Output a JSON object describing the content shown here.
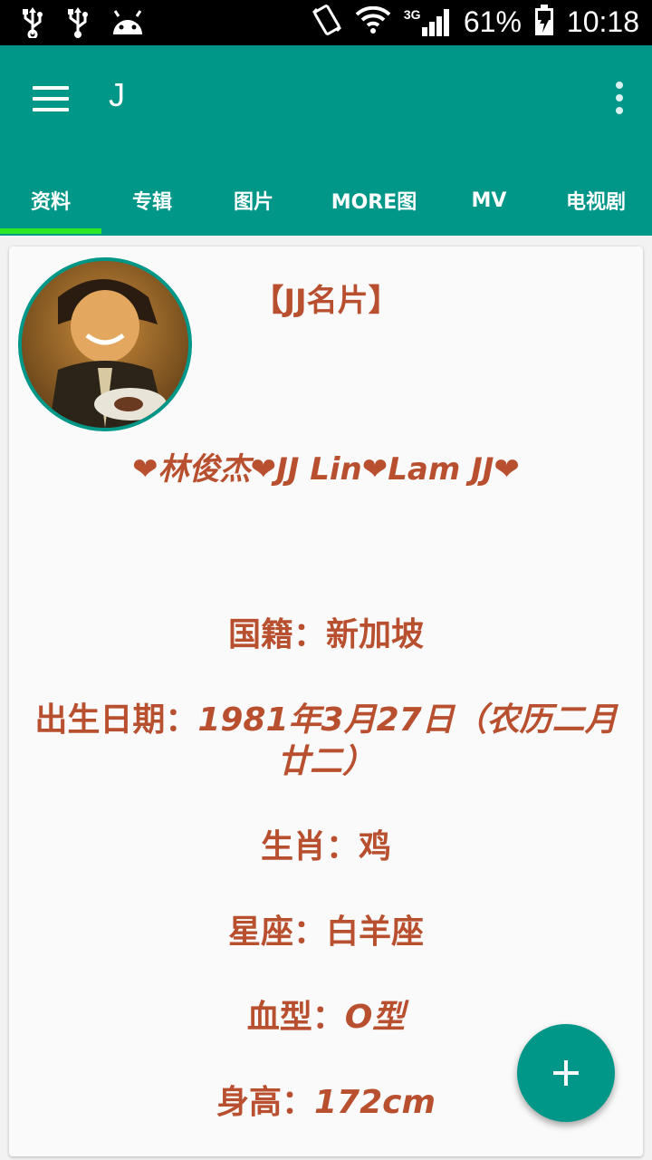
{
  "status_bar": {
    "battery": "61%",
    "time": "10:18",
    "network": "3G"
  },
  "app_bar": {
    "title": "J",
    "menu_icon": "hamburger-menu-icon",
    "overflow_icon": "more-vert-icon",
    "color": "#009688"
  },
  "tabs": [
    {
      "label": "资料",
      "selected": true
    },
    {
      "label": "专辑",
      "selected": false
    },
    {
      "label": "图片",
      "selected": false
    },
    {
      "label": "MORE图",
      "selected": false
    },
    {
      "label": "MV",
      "selected": false
    },
    {
      "label": "电视剧",
      "selected": false
    }
  ],
  "profile": {
    "title": "【JJ名片】",
    "names": {
      "n1": "林俊杰",
      "n2": "JJ Lin",
      "n3": "Lam JJ",
      "heart": "❤"
    },
    "fields": [
      {
        "label": "国籍：",
        "value": "新加坡"
      },
      {
        "label": "出生日期：",
        "value": "1981年3月27日（农历二月廿二）"
      },
      {
        "label": "生肖：",
        "value": "鸡"
      },
      {
        "label": "星座：",
        "value": "白羊座"
      },
      {
        "label": "血型：",
        "value": "O型"
      },
      {
        "label": "身高：",
        "value": "172cm"
      }
    ],
    "text_color": "#b85030"
  },
  "fab": {
    "icon": "plus-icon",
    "label": "+"
  }
}
